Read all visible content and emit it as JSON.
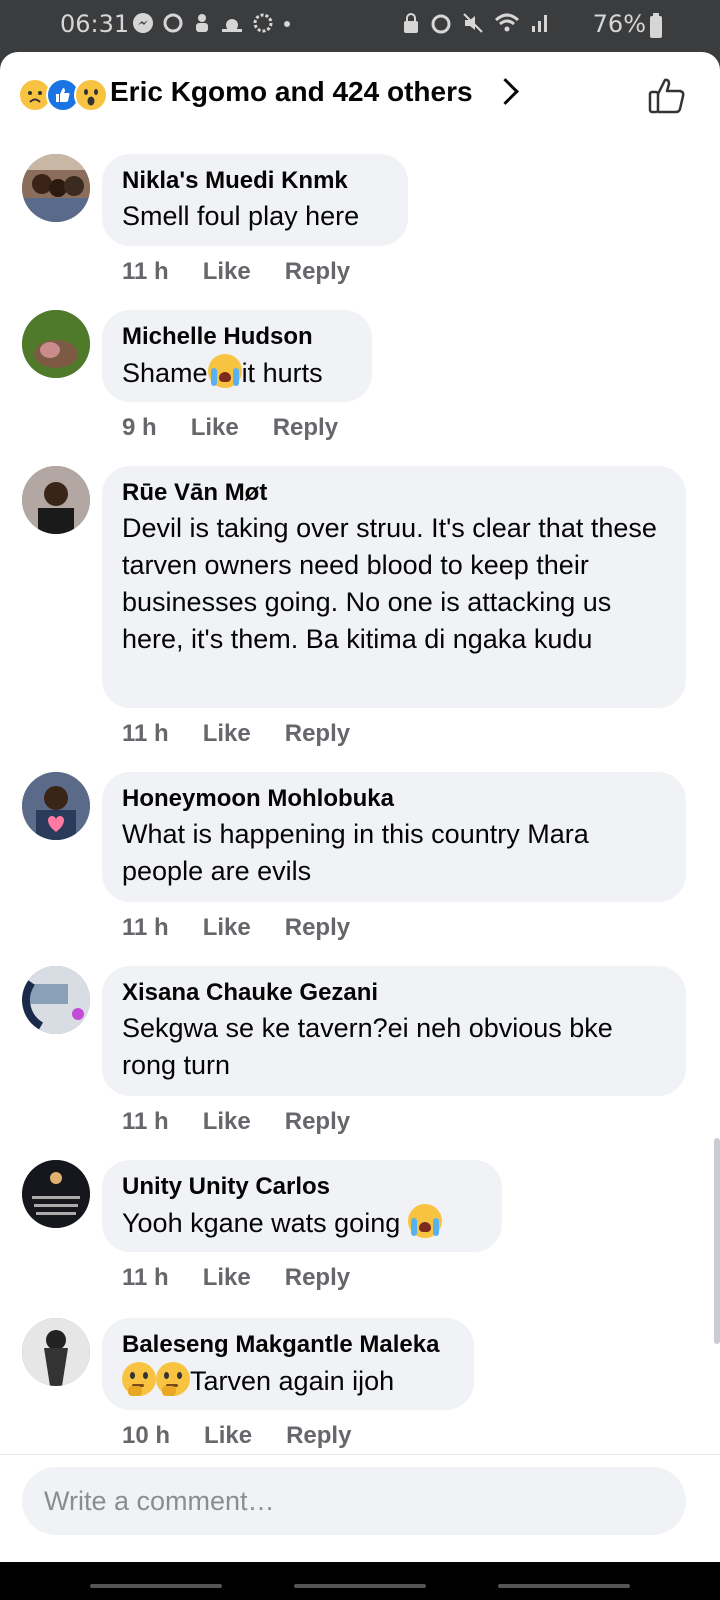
{
  "status_bar": {
    "time": "06:31",
    "battery": "76%",
    "left_icons": [
      "messenger-icon",
      "sync-icon",
      "notification-icon",
      "weather-icon",
      "settings-icon",
      "dot-icon"
    ],
    "right_icons": [
      "lock-icon",
      "alarm-icon",
      "mute-icon",
      "wifi-icon",
      "signal-icon"
    ]
  },
  "header": {
    "reactions": [
      "sad",
      "like",
      "wow"
    ],
    "title": "Eric Kgomo and 424 others"
  },
  "comments": [
    {
      "name": "Nikla's Muedi Knmk",
      "text": "Smell foul play here",
      "time": "11 h",
      "like": "Like",
      "reply": "Reply"
    },
    {
      "name": "Michelle Hudson",
      "text_before": "Shame",
      "text_after": "it hurts",
      "time": "9 h",
      "like": "Like",
      "reply": "Reply"
    },
    {
      "name": "Rūe Vān Møt",
      "text": "Devil is taking over struu. It's clear that these tarven owners need blood to keep their businesses going. No one is attacking us here, it's them. Ba kitima di ngaka kudu",
      "time": "11 h",
      "like": "Like",
      "reply": "Reply"
    },
    {
      "name": "Honeymoon Mohlobuka",
      "text": "What is happening in this country Mara people are evils",
      "time": "11 h",
      "like": "Like",
      "reply": "Reply"
    },
    {
      "name": "Xisana Chauke Gezani",
      "text": "Sekgwa se ke tavern?ei neh obvious bke rong turn",
      "time": "11 h",
      "like": "Like",
      "reply": "Reply"
    },
    {
      "name": "Unity Unity Carlos",
      "text": "Yooh kgane wats going ",
      "time": "11 h",
      "like": "Like",
      "reply": "Reply"
    },
    {
      "name": "Baleseng Makgantle Maleka",
      "text": "Tarven again ijoh",
      "time": "10 h",
      "like": "Like",
      "reply": "Reply"
    }
  ],
  "composer": {
    "placeholder": "Write a comment…"
  },
  "colors": {
    "bubble": "#f0f2f5",
    "meta": "#65676b",
    "like_blue": "#1b74e4",
    "emoji_yellow": "#f7c341"
  }
}
